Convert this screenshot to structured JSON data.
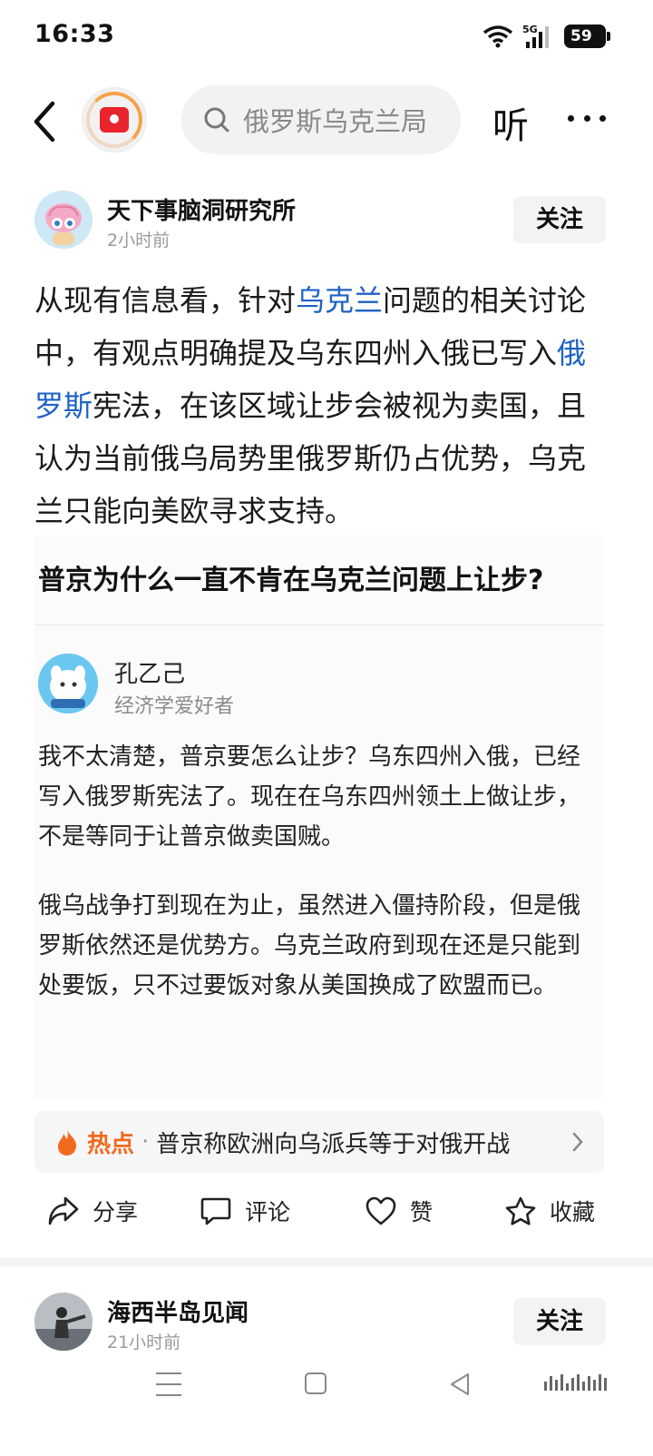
{
  "status_bar": {
    "time": "16:33",
    "network": "5G",
    "battery": "59"
  },
  "nav": {
    "search_placeholder": "俄罗斯乌克兰局",
    "listen_label": "听"
  },
  "post": {
    "author": "天下事脑洞研究所",
    "time": "2小时前",
    "follow_label": "关注",
    "body": [
      {
        "text": "从现有信息看，针对",
        "link": false
      },
      {
        "text": "乌克兰",
        "link": true
      },
      {
        "text": "问题的相关讨论中，有观点明确提及乌东四州入俄已写入",
        "link": false
      },
      {
        "text": "俄罗斯",
        "link": true
      },
      {
        "text": "宪法，在该区域让步会被视为卖国，且认为当前俄乌局势里俄罗斯仍占优势，乌克兰只能向美欧寻求支持。",
        "link": false
      }
    ]
  },
  "quote": {
    "question": "普京为什么一直不肯在乌克兰问题上让步?",
    "answer_author": "孔乙己",
    "answer_tag": "经济学爱好者",
    "paragraphs": [
      "我不太清楚，普京要怎么让步？乌东四州入俄，已经写入俄罗斯宪法了。现在在乌东四州领土上做让步，不是等同于让普京做卖国贼。",
      "俄乌战争打到现在为止，虽然进入僵持阶段，但是俄罗斯依然还是优势方。乌克兰政府到现在还是只能到处要饭，只不过要饭对象从美国换成了欧盟而已。"
    ]
  },
  "hot": {
    "label": "热点",
    "separator": "·",
    "text": "普京称欧洲向乌派兵等于对俄开战"
  },
  "actions": {
    "share": "分享",
    "comment": "评论",
    "like": "赞",
    "favorite": "收藏"
  },
  "next_post": {
    "author": "海西半岛见闻",
    "time": "21小时前",
    "follow_label": "关注"
  },
  "colors": {
    "link": "#1e62c4",
    "hot": "#f06a1c"
  }
}
